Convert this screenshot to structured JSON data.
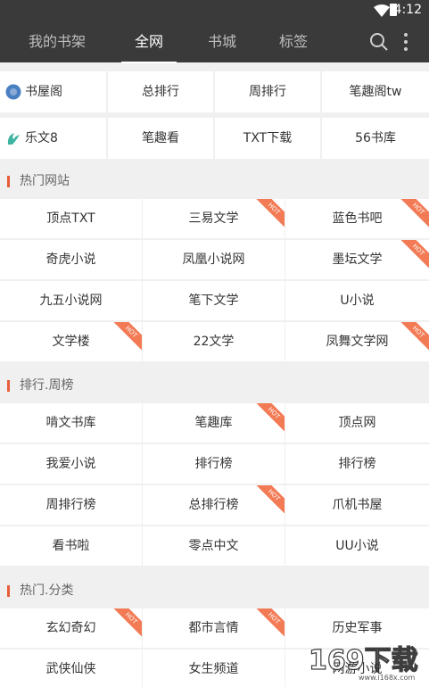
{
  "status": {
    "time": "4:12"
  },
  "tabs": [
    {
      "label": "我的书架",
      "active": false
    },
    {
      "label": "全网",
      "active": true
    },
    {
      "label": "书城",
      "active": false
    },
    {
      "label": "标签",
      "active": false
    }
  ],
  "sources": [
    [
      "书屋阁",
      "总排行",
      "周排行",
      "笔趣阁tw"
    ],
    [
      "乐文8",
      "笔趣看",
      "TXT下载",
      "56书库"
    ]
  ],
  "hot_label": "HOT",
  "sections": [
    {
      "title": "热门网站",
      "rows": [
        [
          {
            "label": "顶点TXT",
            "hot": false
          },
          {
            "label": "三易文学",
            "hot": true
          },
          {
            "label": "蓝色书吧",
            "hot": true
          }
        ],
        [
          {
            "label": "奇虎小说",
            "hot": false
          },
          {
            "label": "凤凰小说网",
            "hot": false
          },
          {
            "label": "墨坛文学",
            "hot": true
          }
        ],
        [
          {
            "label": "九五小说网",
            "hot": false
          },
          {
            "label": "笔下文学",
            "hot": false
          },
          {
            "label": "U小说",
            "hot": false
          }
        ],
        [
          {
            "label": "文学楼",
            "hot": true
          },
          {
            "label": "22文学",
            "hot": false
          },
          {
            "label": "凤舞文学网",
            "hot": true
          }
        ]
      ]
    },
    {
      "title": "排行.周榜",
      "rows": [
        [
          {
            "label": "啃文书库",
            "hot": false
          },
          {
            "label": "笔趣库",
            "hot": true
          },
          {
            "label": "顶点网",
            "hot": false
          }
        ],
        [
          {
            "label": "我爱小说",
            "hot": false
          },
          {
            "label": "排行榜",
            "hot": false
          },
          {
            "label": "排行榜",
            "hot": false
          }
        ],
        [
          {
            "label": "周排行榜",
            "hot": false
          },
          {
            "label": "总排行榜",
            "hot": true
          },
          {
            "label": "爪机书屋",
            "hot": false
          }
        ],
        [
          {
            "label": "看书啦",
            "hot": false
          },
          {
            "label": "零点中文",
            "hot": false
          },
          {
            "label": "UU小说",
            "hot": false
          }
        ]
      ]
    },
    {
      "title": "热门.分类",
      "rows": [
        [
          {
            "label": "玄幻奇幻",
            "hot": true
          },
          {
            "label": "都市言情",
            "hot": true
          },
          {
            "label": "历史军事",
            "hot": false
          }
        ],
        [
          {
            "label": "武侠仙侠",
            "hot": false
          },
          {
            "label": "女生频道",
            "hot": false
          },
          {
            "label": "网游小说",
            "hot": false
          }
        ]
      ]
    }
  ],
  "watermark": {
    "text": "169下载",
    "url": "www.i168x.com"
  },
  "colors": {
    "appbar": "#3a3a3a",
    "hot": "#f27b55",
    "section_bar": "#e85d3a"
  }
}
